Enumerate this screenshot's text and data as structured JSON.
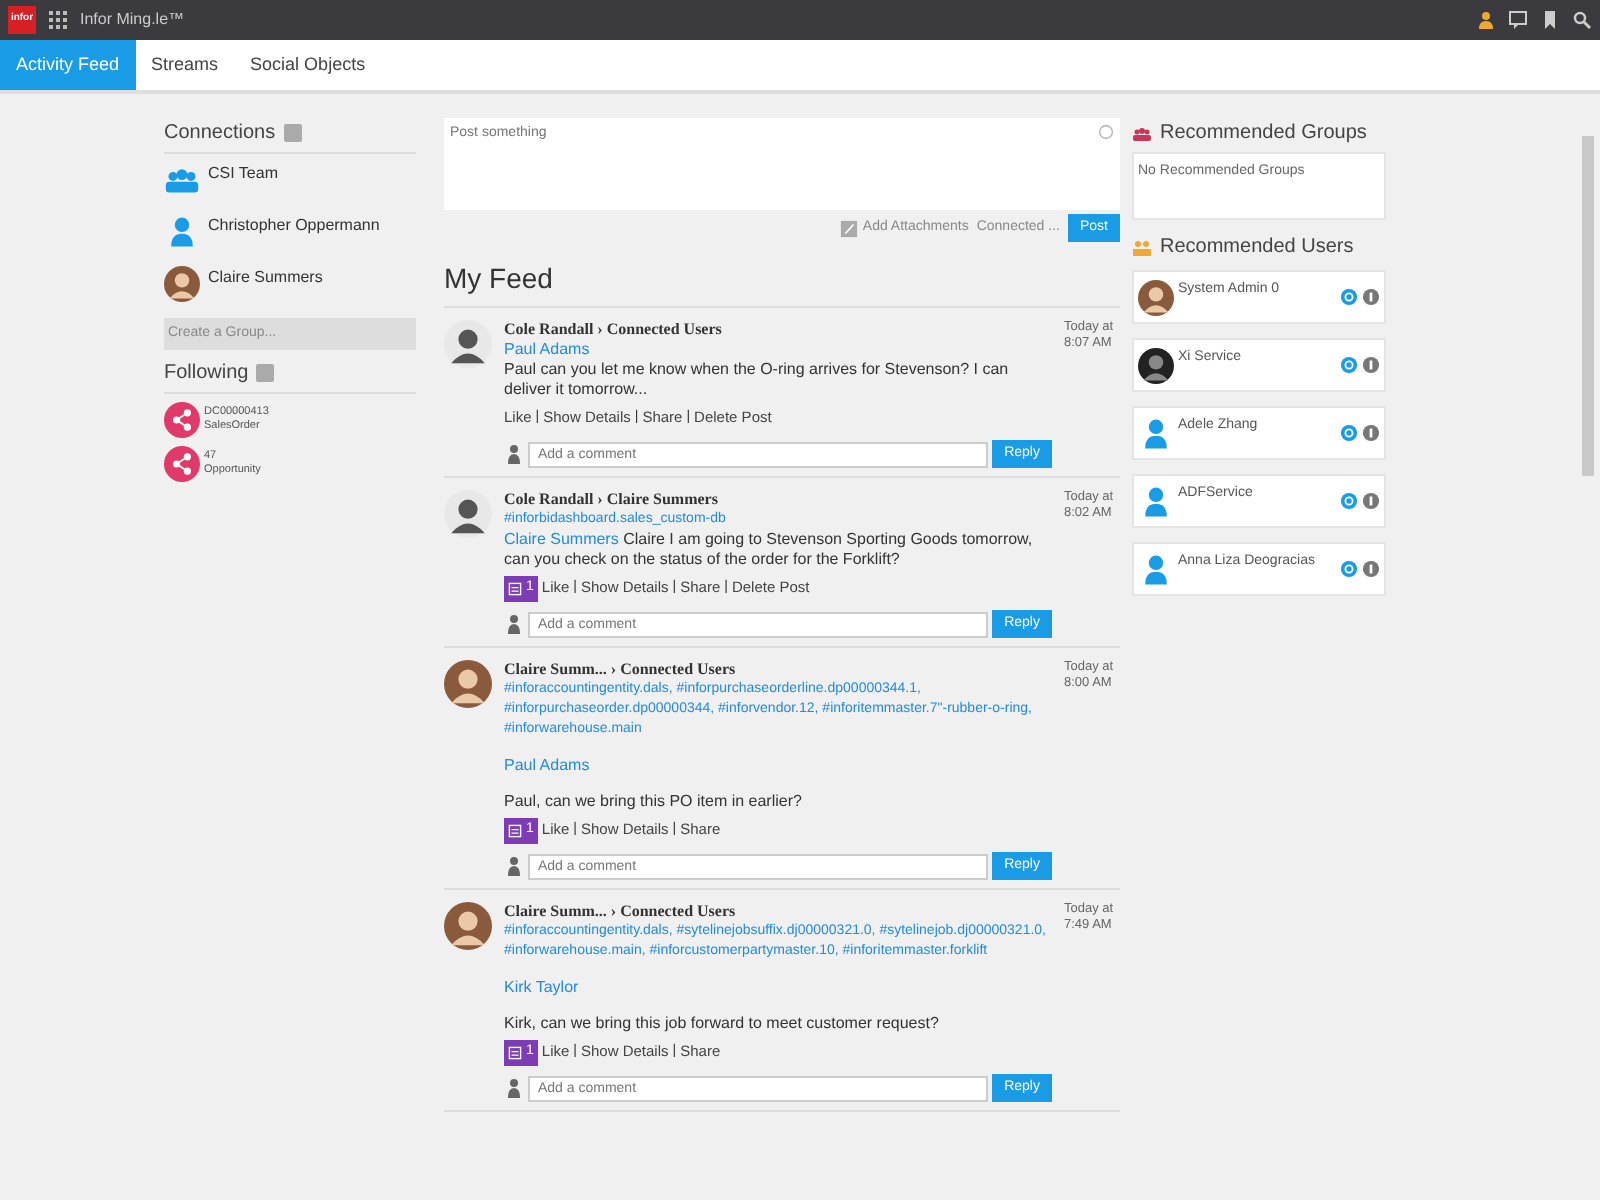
{
  "topbar": {
    "logo": "infor",
    "title": "Infor Ming.le™"
  },
  "tabs": [
    {
      "label": "Activity Feed",
      "selected": true
    },
    {
      "label": "Streams",
      "selected": false
    },
    {
      "label": "Social Objects",
      "selected": false
    }
  ],
  "connections": {
    "title": "Connections",
    "items": [
      {
        "name": "CSI Team",
        "kind": "group"
      },
      {
        "name": "Christopher Oppermann",
        "kind": "user"
      },
      {
        "name": "Claire Summers",
        "kind": "photo"
      }
    ],
    "create_group": "Create a Group..."
  },
  "following": {
    "title": "Following",
    "items": [
      {
        "id": "DC00000413",
        "type": "SalesOrder"
      },
      {
        "id": "47",
        "type": "Opportunity"
      }
    ]
  },
  "composer": {
    "placeholder": "Post something",
    "attach": "Add Attachments",
    "audience": "Connected ...",
    "post": "Post"
  },
  "feed_title": "My Feed",
  "posts": [
    {
      "author": "Cole Randall",
      "target": "Connected Users",
      "time": "Today at 8:07 AM",
      "kind": "man",
      "arrow": "›",
      "separator": "|",
      "mention": "Paul Adams",
      "mention_inline": false,
      "message": "Paul can you let me know when the O-ring arrives for Stevenson? I can deliver it tomorrow...",
      "actions": [
        "Like",
        "Show Details",
        "Share",
        "Delete Post"
      ],
      "comment_placeholder": "Add a comment",
      "reply": "Reply"
    },
    {
      "author": "Cole Randall",
      "target": "Claire Summers",
      "time": "Today at 8:02 AM",
      "kind": "man",
      "arrow": "›",
      "separator": "|",
      "tags": "#inforbidashboard.sales_custom-db",
      "mention": "Claire Summers",
      "mention_inline": true,
      "message": "Claire I am going to Stevenson Sporting Goods tomorrow, can you check on the status of the order for the Forklift?",
      "badge": "1",
      "actions": [
        "Like",
        "Show Details",
        "Share",
        "Delete Post"
      ],
      "comment_placeholder": "Add a comment",
      "reply": "Reply"
    },
    {
      "author": "Claire Summ...",
      "target": "Connected Users",
      "time": "Today at 8:00 AM",
      "kind": "woman",
      "arrow": "›",
      "separator": "|",
      "tags": "#inforaccountingentity.dals, #inforpurchaseorderline.dp00000344.1, #inforpurchaseorder.dp00000344, #inforvendor.12, #inforitemmaster.7\"-rubber-o-ring, #inforwarehouse.main",
      "mention": "Paul Adams",
      "mention_inline": false,
      "message": "Paul, can we bring this PO item in earlier?",
      "badge": "1",
      "actions": [
        "Like",
        "Show Details",
        "Share"
      ],
      "comment_placeholder": "Add a comment",
      "reply": "Reply"
    },
    {
      "author": "Claire Summ...",
      "target": "Connected Users",
      "time": "Today at 7:49 AM",
      "kind": "woman",
      "arrow": "›",
      "separator": "|",
      "tags": "#inforaccountingentity.dals, #sytelinejobsuffix.dj00000321.0, #sytelinejob.dj00000321.0, #inforwarehouse.main, #inforcustomerpartymaster.10, #inforitemmaster.forklift",
      "mention": "Kirk Taylor",
      "mention_inline": false,
      "message": "Kirk, can we bring this job forward to meet customer request?",
      "badge": "1",
      "actions": [
        "Like",
        "Show Details",
        "Share"
      ],
      "comment_placeholder": "Add a comment",
      "reply": "Reply"
    }
  ],
  "recommended_groups": {
    "title": "Recommended Groups",
    "empty": "No Recommended Groups"
  },
  "recommended_users": {
    "title": "Recommended Users",
    "items": [
      {
        "name": "System Admin 0",
        "kind": "photo"
      },
      {
        "name": "Xi Service",
        "kind": "dark"
      },
      {
        "name": "Adele Zhang",
        "kind": "default"
      },
      {
        "name": "ADFService",
        "kind": "default"
      },
      {
        "name": "Anna Liza Deogracias",
        "kind": "default"
      }
    ]
  }
}
